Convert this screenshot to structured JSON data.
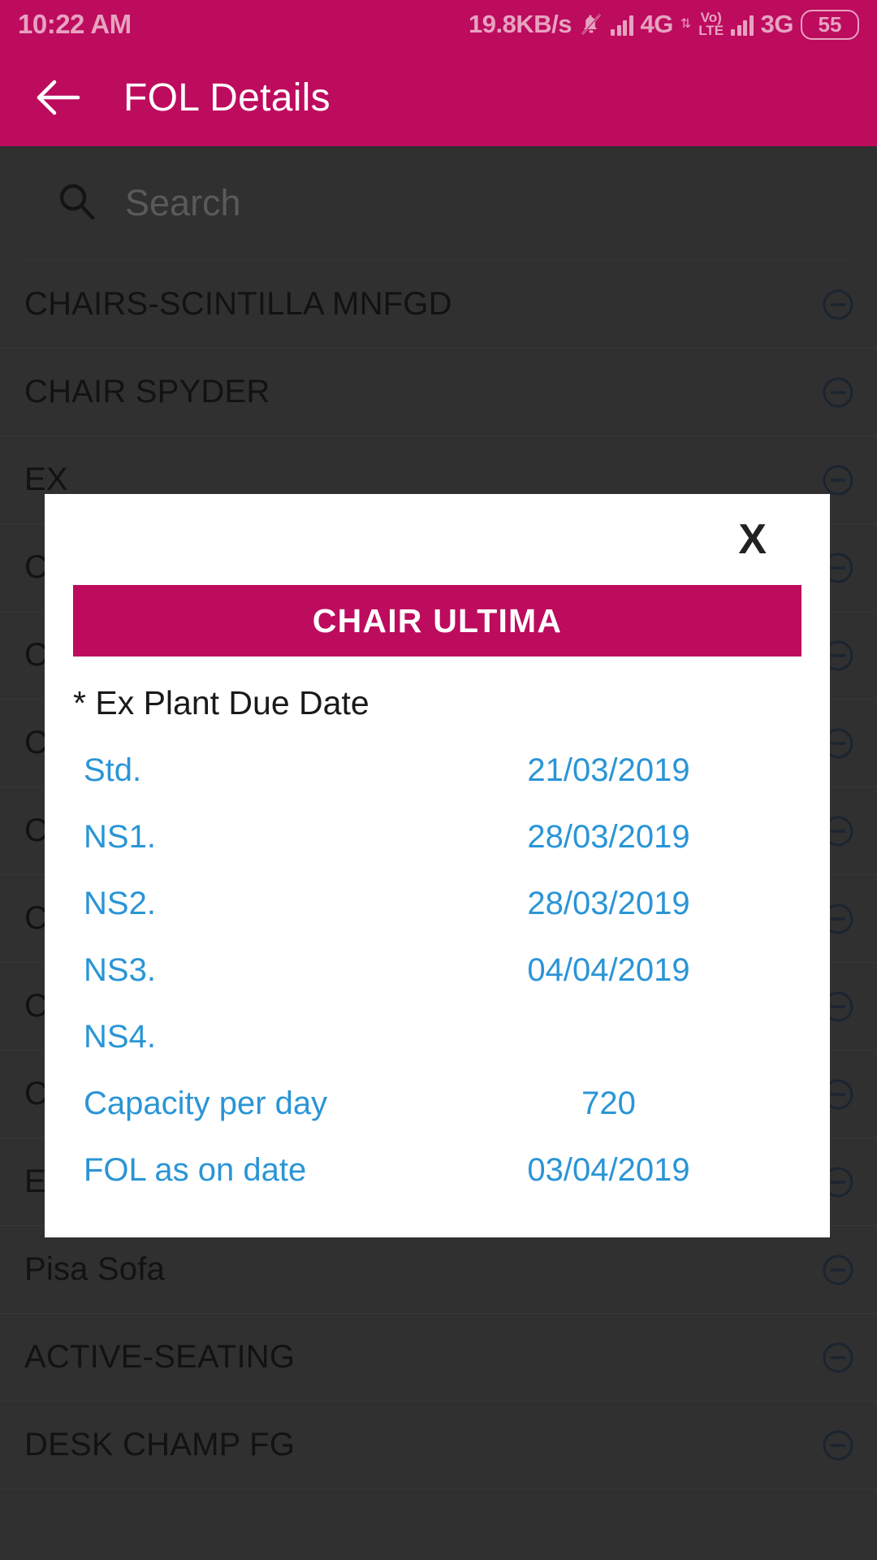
{
  "theme": {
    "brand_magenta": "#BD0B5E",
    "dialog_blue": "#2A95D6",
    "background_dark": "#303030"
  },
  "status_bar": {
    "time": "10:22 AM",
    "network_speed": "19.8KB/s",
    "mute_icon": "bell-mute-icon",
    "sim1_signal_icon": "signal-bars-icon",
    "sim1_network": "4G",
    "data_transfer_icon": "up-down-arrows-icon",
    "volte_top": "Vo)",
    "volte_bottom": "LTE",
    "sim2_signal_icon": "signal-bars-icon",
    "sim2_network": "3G",
    "battery_level": "55"
  },
  "app_bar": {
    "back_icon": "arrow-left-icon",
    "title": "FOL Details"
  },
  "search": {
    "icon": "search-icon",
    "placeholder": "Search",
    "value": ""
  },
  "list": {
    "remove_icon": "minus-circle-icon",
    "items": [
      {
        "label": "CHAIRS-SCINTILLA MNFGD"
      },
      {
        "label": "CHAIR SPYDER"
      },
      {
        "label": "EX"
      },
      {
        "label": "C"
      },
      {
        "label": "C"
      },
      {
        "label": "C"
      },
      {
        "label": "C"
      },
      {
        "label": "C"
      },
      {
        "label": "C"
      },
      {
        "label": "C"
      },
      {
        "label": "EAZYSit"
      },
      {
        "label": "Pisa Sofa"
      },
      {
        "label": "ACTIVE-SEATING"
      },
      {
        "label": "DESK CHAMP FG"
      }
    ]
  },
  "dialog": {
    "close_label": "X",
    "close_icon": "close-icon",
    "title": "CHAIR ULTIMA",
    "section_label": "* Ex Plant Due Date",
    "rows": [
      {
        "key": "Std.",
        "value": "21/03/2019"
      },
      {
        "key": "NS1.",
        "value": "28/03/2019"
      },
      {
        "key": "NS2.",
        "value": "28/03/2019"
      },
      {
        "key": "NS3.",
        "value": "04/04/2019"
      },
      {
        "key": "NS4.",
        "value": ""
      },
      {
        "key": "Capacity per day",
        "value": "720"
      },
      {
        "key": "FOL as on date",
        "value": "03/04/2019"
      }
    ]
  }
}
